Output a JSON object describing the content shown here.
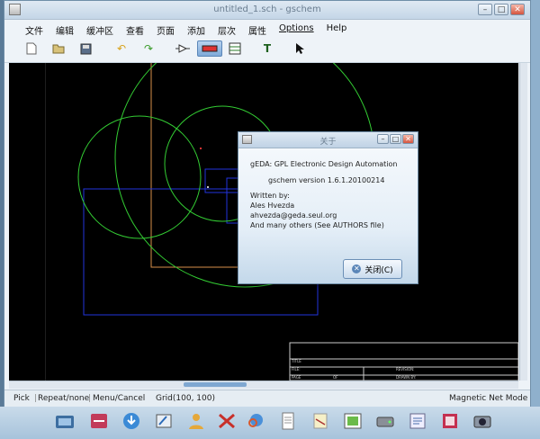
{
  "window": {
    "title": "untitled_1.sch - gschem"
  },
  "menu": [
    "文件",
    "编辑",
    "缓冲区",
    "查看",
    "页面",
    "添加",
    "层次",
    "属性",
    "Options",
    "Help"
  ],
  "toolbar": {
    "icons": [
      "new-page-icon",
      "open-folder-icon",
      "save-icon",
      "undo-icon",
      "redo-icon",
      "add-component-icon",
      "add-net-icon",
      "add-bus-icon",
      "add-text-icon",
      "select-pointer-icon"
    ]
  },
  "canvas": {
    "background": "#000000",
    "title_block": {
      "title": "TITLE",
      "file": "FILE:",
      "page": "PAGE",
      "revision": "REVISION:",
      "drawn_by": "DRAWN BY:",
      "of": "OF"
    }
  },
  "status": {
    "pick": "Pick",
    "repeat": "Repeat/none",
    "menu": "Menu/Cancel",
    "grid": "Grid(100, 100)",
    "mode": "Magnetic Net Mode"
  },
  "about": {
    "title": "关于",
    "heading": "gEDA: GPL Electronic Design Automation",
    "version": "gschem version 1.6.1.20100214",
    "written_by": "Written by:",
    "author": "Ales Hvezda",
    "email": "ahvezda@geda.seul.org",
    "others": "And many others (See AUTHORS file)",
    "close_label": "关闭(C)"
  },
  "taskbar": {
    "icons": [
      "finder-icon",
      "system-monitor-icon",
      "download-icon",
      "paint-icon",
      "user-icon",
      "tools-icon",
      "search-globe-icon",
      "document-icon",
      "notes-icon",
      "image-viewer-icon",
      "drive-icon",
      "text-editor-icon",
      "file-manager-icon",
      "camera-icon"
    ]
  }
}
